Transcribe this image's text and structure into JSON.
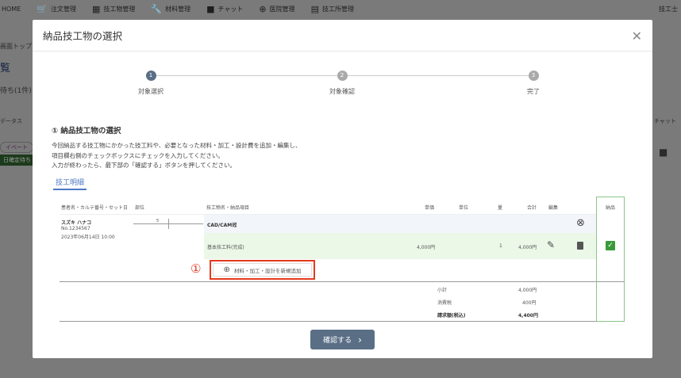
{
  "nav": {
    "items": [
      {
        "label": "HOME",
        "icon": "home-icon"
      },
      {
        "label": "注文管理",
        "icon": "cart-icon"
      },
      {
        "label": "技工物管理",
        "icon": "box-icon"
      },
      {
        "label": "材料管理",
        "icon": "wrench-icon"
      },
      {
        "label": "チャット",
        "icon": "chat-icon"
      },
      {
        "label": "医院管理",
        "icon": "hospital-icon"
      },
      {
        "label": "技工所管理",
        "icon": "building-icon"
      }
    ],
    "user": "技工士"
  },
  "background": {
    "breadcrumb": "画面トップ",
    "title": "覧",
    "pending": "待ち(1件)",
    "status": "データス",
    "tag1": "イベート",
    "tag2": "日確定待ち",
    "chat": "チャット"
  },
  "modal": {
    "title": "納品技工物の選択",
    "steps": [
      {
        "num": "1",
        "label": "対象選択"
      },
      {
        "num": "2",
        "label": "対象確認"
      },
      {
        "num": "3",
        "label": "完了"
      }
    ],
    "section_title": "① 納品技工物の選択",
    "description": [
      "今回納品する技工物にかかった技工料や、必要となった材料・加工・設計費を追加・編集し、",
      "項目欄右側のチェックボックスにチェックを入力してください。",
      "入力が終わったら、最下部の「確認する」ボタンを押してください。"
    ],
    "tab": "技工明細",
    "headers": {
      "patient": "患者名・カルテ番号・セット日",
      "site": "部位",
      "item": "技工物名・納品項目",
      "price": "単価",
      "unit": "単位",
      "qty": "量",
      "total": "合計",
      "edit": "編集",
      "deliver": "納品"
    },
    "patient": {
      "name": "スズキ ハナコ",
      "no": "No.1234567",
      "date": "2023年06月14日 10:00"
    },
    "tooth": "5",
    "product": "CAD/CAM冠",
    "line": {
      "name": "基本技工料(完成)",
      "price": "4,000円",
      "qty": "1",
      "total": "4,000円",
      "checked": true
    },
    "annotation": "①",
    "add_button": "材料・加工・設計を新規追加",
    "summary": [
      {
        "label": "小計",
        "value": "4,000円"
      },
      {
        "label": "消費税",
        "value": "400円"
      },
      {
        "label": "請求額(税込)",
        "value": "4,400円"
      }
    ],
    "confirm": "確認する",
    "colors": {
      "accent": "#4a79c4",
      "check": "#3a9a3a",
      "highlight": "#e53a1e"
    }
  }
}
